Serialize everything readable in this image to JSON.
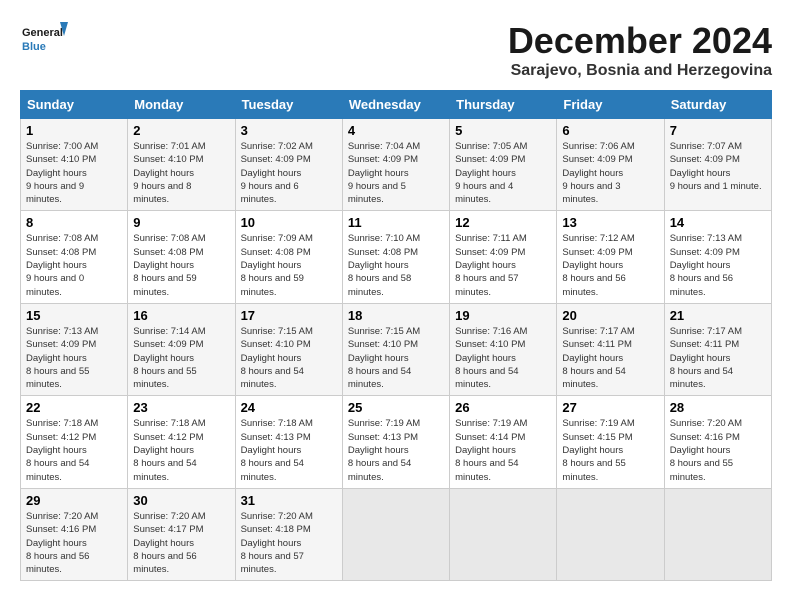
{
  "header": {
    "logo_general": "General",
    "logo_blue": "Blue",
    "month_title": "December 2024",
    "subtitle": "Sarajevo, Bosnia and Herzegovina"
  },
  "days_of_week": [
    "Sunday",
    "Monday",
    "Tuesday",
    "Wednesday",
    "Thursday",
    "Friday",
    "Saturday"
  ],
  "weeks": [
    [
      {
        "day": 1,
        "sunrise": "7:00 AM",
        "sunset": "4:10 PM",
        "daylight": "9 hours and 9 minutes."
      },
      {
        "day": 2,
        "sunrise": "7:01 AM",
        "sunset": "4:10 PM",
        "daylight": "9 hours and 8 minutes."
      },
      {
        "day": 3,
        "sunrise": "7:02 AM",
        "sunset": "4:09 PM",
        "daylight": "9 hours and 6 minutes."
      },
      {
        "day": 4,
        "sunrise": "7:04 AM",
        "sunset": "4:09 PM",
        "daylight": "9 hours and 5 minutes."
      },
      {
        "day": 5,
        "sunrise": "7:05 AM",
        "sunset": "4:09 PM",
        "daylight": "9 hours and 4 minutes."
      },
      {
        "day": 6,
        "sunrise": "7:06 AM",
        "sunset": "4:09 PM",
        "daylight": "9 hours and 3 minutes."
      },
      {
        "day": 7,
        "sunrise": "7:07 AM",
        "sunset": "4:09 PM",
        "daylight": "9 hours and 1 minute."
      }
    ],
    [
      {
        "day": 8,
        "sunrise": "7:08 AM",
        "sunset": "4:08 PM",
        "daylight": "9 hours and 0 minutes."
      },
      {
        "day": 9,
        "sunrise": "7:08 AM",
        "sunset": "4:08 PM",
        "daylight": "8 hours and 59 minutes."
      },
      {
        "day": 10,
        "sunrise": "7:09 AM",
        "sunset": "4:08 PM",
        "daylight": "8 hours and 59 minutes."
      },
      {
        "day": 11,
        "sunrise": "7:10 AM",
        "sunset": "4:08 PM",
        "daylight": "8 hours and 58 minutes."
      },
      {
        "day": 12,
        "sunrise": "7:11 AM",
        "sunset": "4:09 PM",
        "daylight": "8 hours and 57 minutes."
      },
      {
        "day": 13,
        "sunrise": "7:12 AM",
        "sunset": "4:09 PM",
        "daylight": "8 hours and 56 minutes."
      },
      {
        "day": 14,
        "sunrise": "7:13 AM",
        "sunset": "4:09 PM",
        "daylight": "8 hours and 56 minutes."
      }
    ],
    [
      {
        "day": 15,
        "sunrise": "7:13 AM",
        "sunset": "4:09 PM",
        "daylight": "8 hours and 55 minutes."
      },
      {
        "day": 16,
        "sunrise": "7:14 AM",
        "sunset": "4:09 PM",
        "daylight": "8 hours and 55 minutes."
      },
      {
        "day": 17,
        "sunrise": "7:15 AM",
        "sunset": "4:10 PM",
        "daylight": "8 hours and 54 minutes."
      },
      {
        "day": 18,
        "sunrise": "7:15 AM",
        "sunset": "4:10 PM",
        "daylight": "8 hours and 54 minutes."
      },
      {
        "day": 19,
        "sunrise": "7:16 AM",
        "sunset": "4:10 PM",
        "daylight": "8 hours and 54 minutes."
      },
      {
        "day": 20,
        "sunrise": "7:17 AM",
        "sunset": "4:11 PM",
        "daylight": "8 hours and 54 minutes."
      },
      {
        "day": 21,
        "sunrise": "7:17 AM",
        "sunset": "4:11 PM",
        "daylight": "8 hours and 54 minutes."
      }
    ],
    [
      {
        "day": 22,
        "sunrise": "7:18 AM",
        "sunset": "4:12 PM",
        "daylight": "8 hours and 54 minutes."
      },
      {
        "day": 23,
        "sunrise": "7:18 AM",
        "sunset": "4:12 PM",
        "daylight": "8 hours and 54 minutes."
      },
      {
        "day": 24,
        "sunrise": "7:18 AM",
        "sunset": "4:13 PM",
        "daylight": "8 hours and 54 minutes."
      },
      {
        "day": 25,
        "sunrise": "7:19 AM",
        "sunset": "4:13 PM",
        "daylight": "8 hours and 54 minutes."
      },
      {
        "day": 26,
        "sunrise": "7:19 AM",
        "sunset": "4:14 PM",
        "daylight": "8 hours and 54 minutes."
      },
      {
        "day": 27,
        "sunrise": "7:19 AM",
        "sunset": "4:15 PM",
        "daylight": "8 hours and 55 minutes."
      },
      {
        "day": 28,
        "sunrise": "7:20 AM",
        "sunset": "4:16 PM",
        "daylight": "8 hours and 55 minutes."
      }
    ],
    [
      {
        "day": 29,
        "sunrise": "7:20 AM",
        "sunset": "4:16 PM",
        "daylight": "8 hours and 56 minutes."
      },
      {
        "day": 30,
        "sunrise": "7:20 AM",
        "sunset": "4:17 PM",
        "daylight": "8 hours and 56 minutes."
      },
      {
        "day": 31,
        "sunrise": "7:20 AM",
        "sunset": "4:18 PM",
        "daylight": "8 hours and 57 minutes."
      },
      null,
      null,
      null,
      null
    ]
  ]
}
